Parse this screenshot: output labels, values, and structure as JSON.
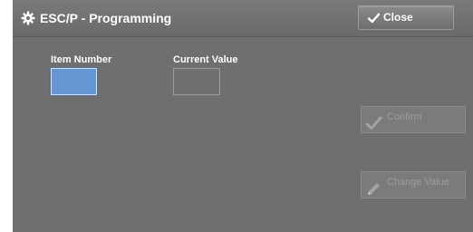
{
  "window": {
    "title": "ESC/P - Programming",
    "title_icon": "gear-icon"
  },
  "toolbar": {
    "close_label": "Close",
    "close_icon": "checkmark-icon"
  },
  "fields": {
    "item_number_label": "Item Number",
    "item_number_value": "",
    "current_value_label": "Current Value",
    "current_value": ""
  },
  "actions": {
    "confirm_label": "Confirm",
    "confirm_icon": "checkmark-icon",
    "confirm_enabled": false,
    "change_value_label": "Change Value",
    "change_value_icon": "pencil-icon",
    "change_value_enabled": false
  },
  "colors": {
    "panel_background": "#6f6f6f",
    "selected_field": "#6596d3",
    "disabled_text": "#9c9c9c"
  }
}
